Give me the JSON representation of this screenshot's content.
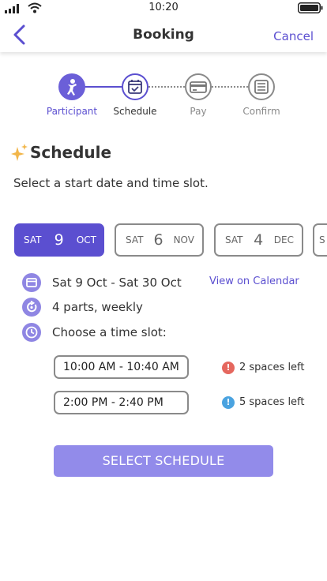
{
  "status": {
    "time": "10:20"
  },
  "header": {
    "title": "Booking",
    "cancel_label": "Cancel"
  },
  "stepper": {
    "steps": [
      {
        "label": "Participant",
        "state": "done"
      },
      {
        "label": "Schedule",
        "state": "current"
      },
      {
        "label": "Pay",
        "state": "upcoming"
      },
      {
        "label": "Confirm",
        "state": "upcoming"
      }
    ]
  },
  "section": {
    "title": "Schedule",
    "subtitle": "Select a start date and time slot."
  },
  "dates": [
    {
      "dow": "SAT",
      "day": "9",
      "month": "OCT",
      "selected": true
    },
    {
      "dow": "SAT",
      "day": "6",
      "month": "NOV",
      "selected": false
    },
    {
      "dow": "SAT",
      "day": "4",
      "month": "DEC",
      "selected": false
    },
    {
      "dow": "S",
      "day": "",
      "month": "",
      "selected": false
    }
  ],
  "info": {
    "range": "Sat 9 Oct - Sat 30 Oct",
    "calendar_link": "View on Calendar",
    "parts": "4 parts, weekly",
    "slot_prompt": "Choose a time slot:"
  },
  "slots": [
    {
      "time": "10:00 AM - 10:40 AM",
      "spaces": "2 spaces left",
      "alert_color": "#e5675e"
    },
    {
      "time": "2:00 PM - 2:40 PM",
      "spaces": "5 spaces left",
      "alert_color": "#4aa3e0"
    }
  ],
  "action": {
    "label": "SELECT SCHEDULE"
  },
  "colors": {
    "accent": "#5b4fd0",
    "accent_light": "#928bea",
    "muted": "#8a8a8a"
  }
}
